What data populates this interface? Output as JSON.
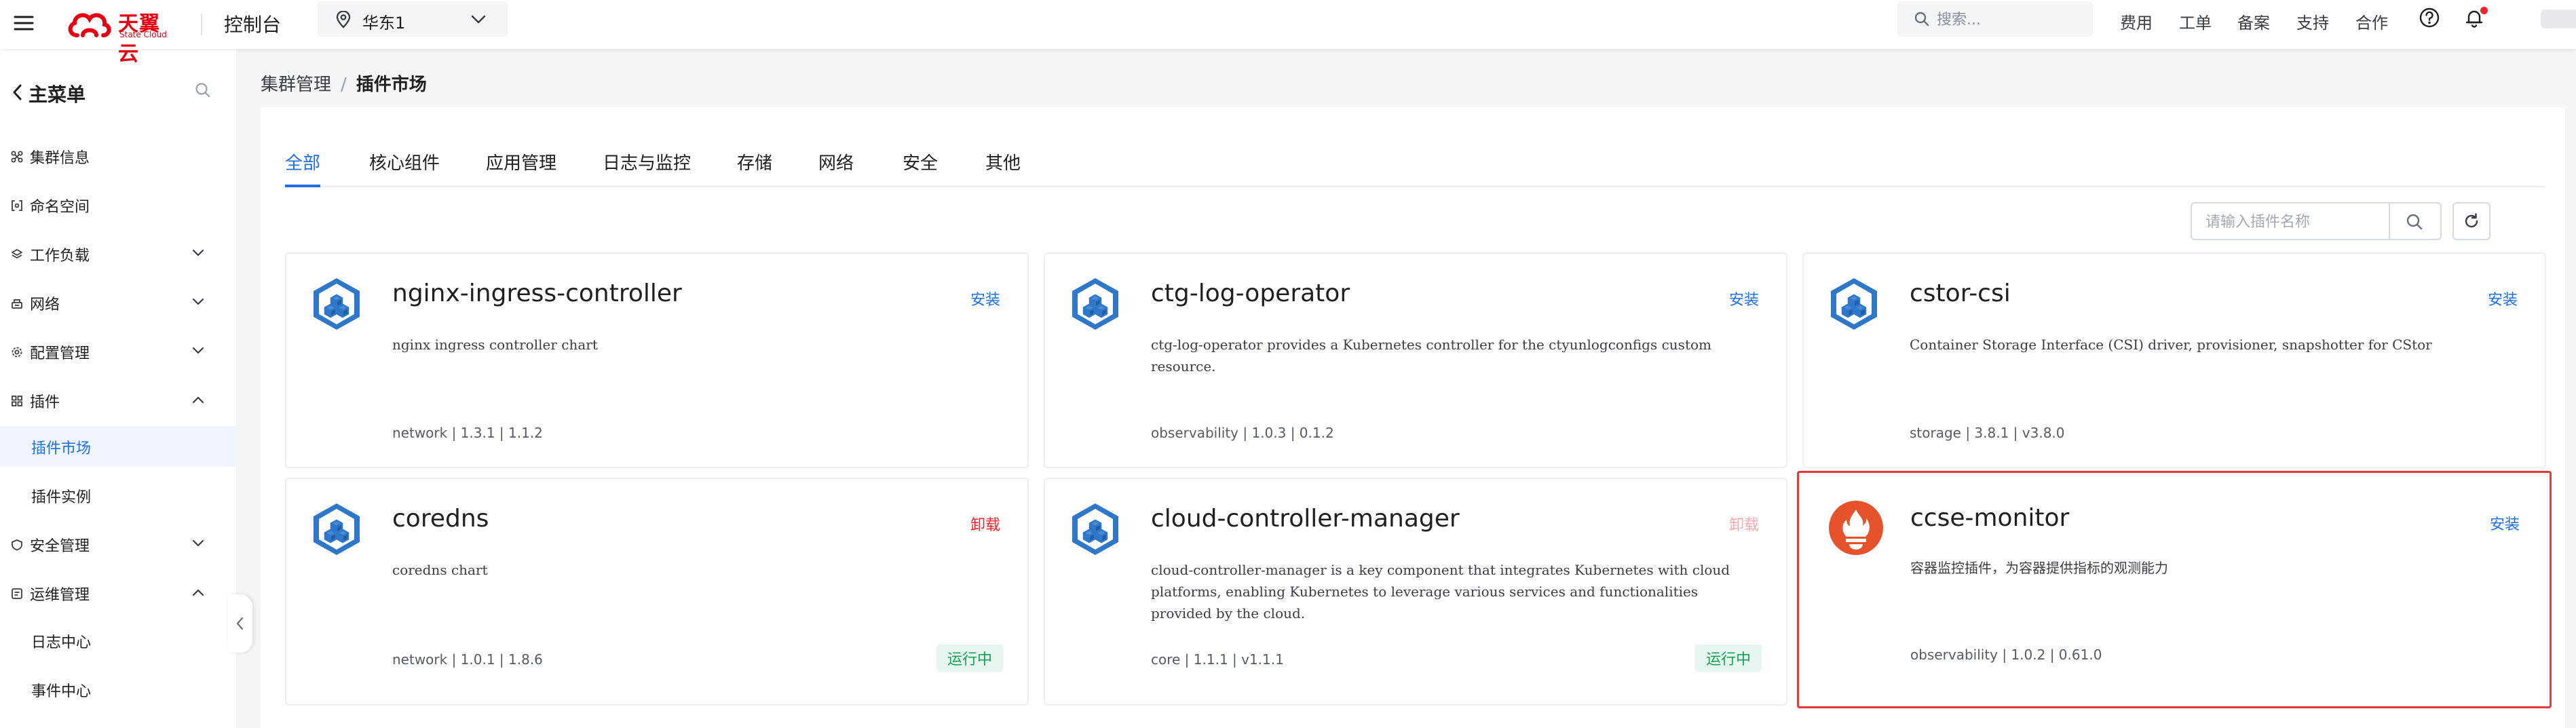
{
  "topbar": {
    "logo_cn": "天翼云",
    "logo_en": "State Cloud",
    "console": "控制台",
    "region": "华东1",
    "search_placeholder": "搜索...",
    "links": [
      "费用",
      "工单",
      "备案",
      "支持",
      "合作"
    ]
  },
  "sidebar": {
    "title": "主菜单",
    "items": [
      {
        "label": "集群信息"
      },
      {
        "label": "命名空间"
      },
      {
        "label": "工作负载"
      },
      {
        "label": "网络"
      },
      {
        "label": "配置管理"
      },
      {
        "label": "插件"
      },
      {
        "label": "插件市场"
      },
      {
        "label": "插件实例"
      },
      {
        "label": "安全管理"
      },
      {
        "label": "运维管理"
      },
      {
        "label": "日志中心"
      },
      {
        "label": "事件中心"
      }
    ]
  },
  "breadcrumb": {
    "parent": "集群管理",
    "sep": "/",
    "current": "插件市场"
  },
  "tabs": [
    "全部",
    "核心组件",
    "应用管理",
    "日志与监控",
    "存储",
    "网络",
    "安全",
    "其他"
  ],
  "plugin_search": {
    "placeholder": "请输入插件名称"
  },
  "cards": [
    {
      "name": "nginx-ingress-controller",
      "action": "安装",
      "desc": "nginx ingress controller chart",
      "meta": "network | 1.3.1 | 1.1.2"
    },
    {
      "name": "ctg-log-operator",
      "action": "安装",
      "desc": "ctg-log-operator provides a Kubernetes controller for the ctyunlogconfigs custom resource.",
      "meta": "observability | 1.0.3 | 0.1.2"
    },
    {
      "name": "cstor-csi",
      "action": "安装",
      "desc": "Container Storage Interface (CSI) driver, provisioner, snapshotter for CStor",
      "meta": "storage | 3.8.1 | v3.8.0"
    },
    {
      "name": "coredns",
      "action": "卸载",
      "desc": "coredns chart",
      "meta": "network | 1.0.1 | 1.8.6",
      "status": "运行中"
    },
    {
      "name": "cloud-controller-manager",
      "action": "卸载",
      "desc": "cloud-controller-manager is a key component that integrates Kubernetes with cloud platforms, enabling Kubernetes to leverage various services and functionalities provided by the cloud.",
      "meta": "core | 1.1.1 | v1.1.1",
      "status": "运行中"
    },
    {
      "name": "ccse-monitor",
      "action": "安装",
      "desc": "容器监控插件，为容器提供指标的观测能力",
      "meta": "observability | 1.0.2 | 0.61.0"
    }
  ],
  "colors": {
    "accent": "#1f6fe5",
    "danger": "#f5222d",
    "success": "#18a058",
    "brand": "#e60012",
    "prometheus": "#e6522c",
    "selection": "#e53935"
  }
}
